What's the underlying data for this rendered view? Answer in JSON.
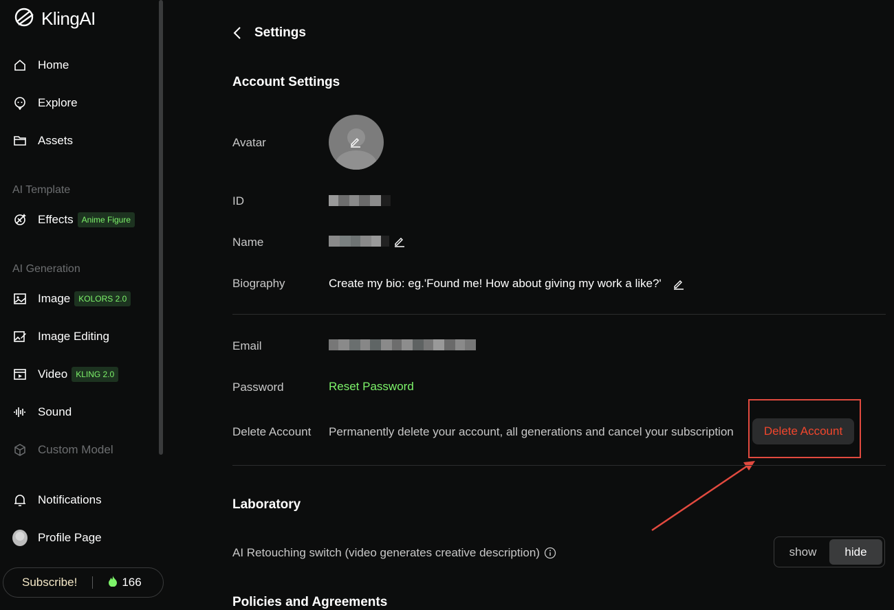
{
  "app": {
    "name": "KlingAI"
  },
  "sidebar": {
    "nav": [
      {
        "label": "Home",
        "icon": "home-icon"
      },
      {
        "label": "Explore",
        "icon": "explore-icon"
      },
      {
        "label": "Assets",
        "icon": "folder-icon"
      }
    ],
    "ai_template_label": "AI Template",
    "effects": {
      "label": "Effects",
      "badge": "Anime Figure"
    },
    "ai_generation_label": "AI Generation",
    "generation": [
      {
        "label": "Image",
        "badge": "KOLORS 2.0"
      },
      {
        "label": "Image Editing"
      },
      {
        "label": "Video",
        "badge": "KLING 2.0"
      },
      {
        "label": "Sound"
      },
      {
        "label": "Custom Model"
      }
    ],
    "notifications": "Notifications",
    "profile": "Profile Page",
    "subscribe": "Subscribe!",
    "credits": "166"
  },
  "settings": {
    "title": "Settings",
    "account_title": "Account Settings",
    "labels": {
      "avatar": "Avatar",
      "id": "ID",
      "name": "Name",
      "biography": "Biography",
      "email": "Email",
      "password": "Password",
      "delete": "Delete Account"
    },
    "biography_value": "Create my bio: eg.'Found me! How about giving my work a like?'",
    "reset_password": "Reset Password",
    "delete_description": "Permanently delete your account, all generations and cancel your subscription",
    "delete_button": "Delete Account",
    "laboratory_title": "Laboratory",
    "retouching_label": "AI Retouching switch (video generates creative description)",
    "toggle": {
      "show": "show",
      "hide": "hide",
      "selected": "hide"
    },
    "next_section_title": "Policies and Agreements"
  },
  "colors": {
    "accent_green": "#7df36a",
    "danger": "#f0462d",
    "highlight": "#e24a3f"
  }
}
